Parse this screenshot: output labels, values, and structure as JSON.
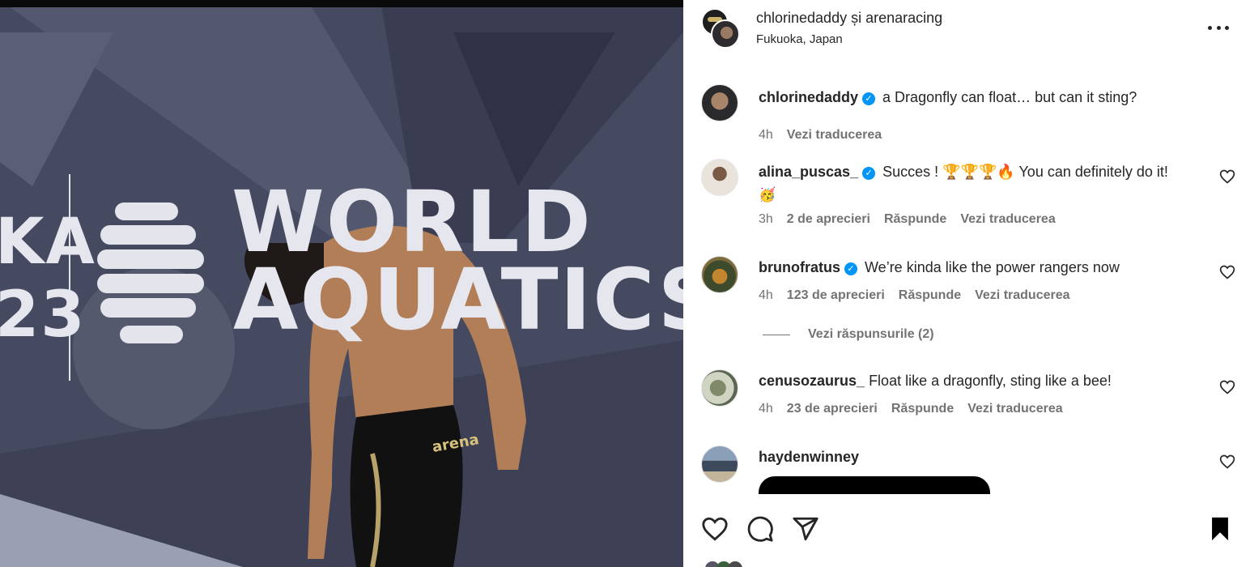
{
  "post": {
    "header_users": "chlorinedaddy și arenaracing",
    "location": "Fukuoka, Japan",
    "media": {
      "backdrop_line1": "WORLD",
      "backdrop_line2": "AQUATICS",
      "backdrop_left_line1": "KA",
      "backdrop_left_line2": "23",
      "suit_brand": "arena"
    }
  },
  "caption": {
    "username": "chlorinedaddy",
    "text": "a Dragonfly can float… but can it sting?",
    "time": "4h",
    "translate": "Vezi traducerea"
  },
  "comments": [
    {
      "username": "alina_puscas_",
      "verified": true,
      "text": "Succes ! 🏆🏆🏆🔥 You can definitely do it!",
      "text_line2": "🥳",
      "time": "3h",
      "likes": "2 de aprecieri",
      "reply": "Răspunde",
      "translate": "Vezi traducerea"
    },
    {
      "username": "brunofratus",
      "verified": true,
      "text": "We’re kinda like the power rangers now",
      "time": "4h",
      "likes": "123 de aprecieri",
      "reply": "Răspunde",
      "translate": "Vezi traducerea",
      "view_replies": "Vezi răspunsurile (2)"
    },
    {
      "username": "cenusozaurus_",
      "verified": false,
      "text": "Float like a dragonfly, sting like a bee!",
      "time": "4h",
      "likes": "23 de aprecieri",
      "reply": "Răspunde",
      "translate": "Vezi traducerea"
    },
    {
      "username": "haydenwinney",
      "verified": false
    }
  ],
  "icons": {
    "more": "more-options-icon",
    "like": "heart-icon",
    "comment": "comment-bubble-icon",
    "share": "paper-plane-icon",
    "save": "bookmark-filled-icon",
    "comment_like": "heart-small-icon",
    "verified": "verified-badge-icon"
  },
  "colors": {
    "verified": "#0095f6",
    "text_primary": "#262626",
    "text_secondary": "#737373"
  }
}
